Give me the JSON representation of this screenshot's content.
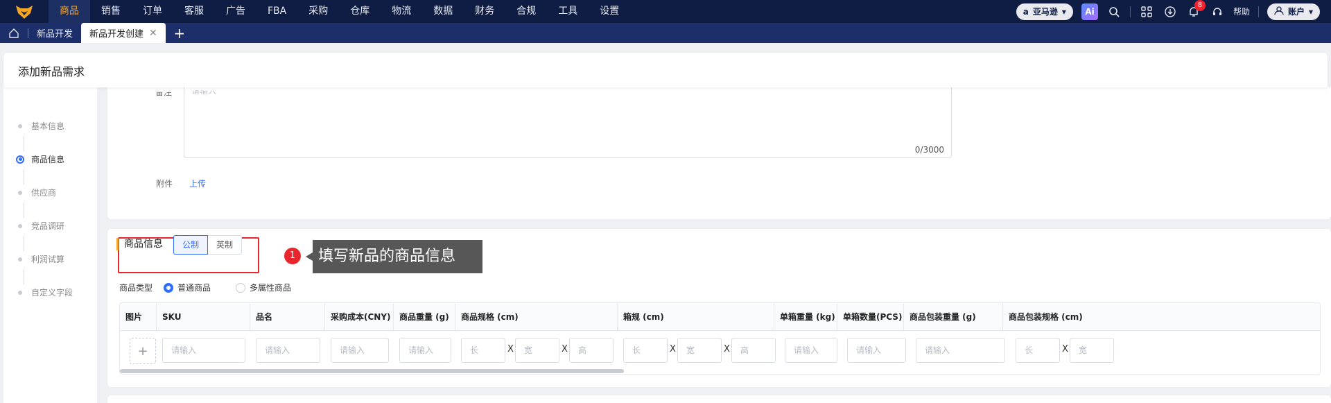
{
  "topnav": {
    "items": [
      "商品",
      "销售",
      "订单",
      "客服",
      "广告",
      "FBA",
      "采购",
      "仓库",
      "物流",
      "数据",
      "财务",
      "合规",
      "工具",
      "设置"
    ],
    "active_index": 0,
    "market": "亚马逊",
    "bell_count": "8",
    "help": "帮助",
    "account": "账户",
    "accent_color": "#f6a623"
  },
  "tabs": {
    "items": [
      {
        "label": "新品开发",
        "active": false
      },
      {
        "label": "新品开发创建",
        "active": true
      }
    ]
  },
  "page": {
    "title": "添加新品需求"
  },
  "steps": [
    "基本信息",
    "商品信息",
    "供应商",
    "竞品调研",
    "利润试算",
    "自定义字段"
  ],
  "active_step": 1,
  "remark": {
    "label": "备注",
    "placeholder": "请输入",
    "count": "0/3000"
  },
  "attachment": {
    "label": "附件",
    "link": "上传"
  },
  "product": {
    "section_title": "商品信息",
    "unit_metric": "公制",
    "unit_imperial": "英制",
    "callout_number": "1",
    "callout_text": "填写新品的商品信息",
    "type_label": "商品类型",
    "type_normal": "普通商品",
    "type_multi": "多属性商品",
    "columns": [
      "图片",
      "SKU",
      "品名",
      "采购成本(CNY)",
      "商品重量 (g)",
      "商品规格 (cm)",
      "箱规 (cm)",
      "单箱重量 (kg)",
      "单箱数量(PCS)",
      "商品包装重量 (g)",
      "商品包装规格 (cm)"
    ],
    "input_placeholder": "请输入",
    "dim_long": "长",
    "dim_wide": "宽",
    "dim_high": "高",
    "x_sep": "X"
  }
}
